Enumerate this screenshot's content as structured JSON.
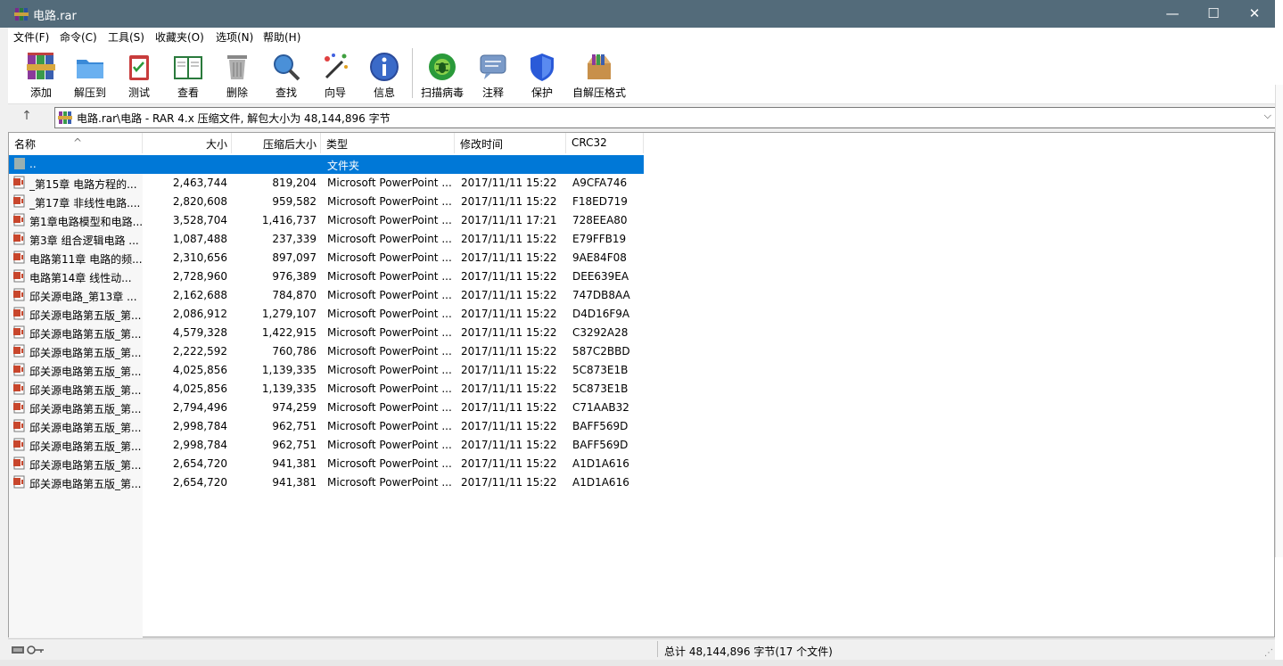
{
  "window": {
    "title": "电路.rar",
    "minimize": "—",
    "maximize": "☐",
    "close": "✕"
  },
  "menu": [
    "文件(F)",
    "命令(C)",
    "工具(S)",
    "收藏夹(O)",
    "选项(N)",
    "帮助(H)"
  ],
  "toolbar": {
    "add": "添加",
    "extract": "解压到",
    "test": "测试",
    "view": "查看",
    "delete": "删除",
    "find": "查找",
    "wizard": "向导",
    "info": "信息",
    "scan": "扫描病毒",
    "comment": "注释",
    "protect": "保护",
    "sfx": "自解压格式"
  },
  "address": {
    "up": "↑",
    "path": "电路.rar\\电路 - RAR 4.x 压缩文件, 解包大小为 48,144,896 字节",
    "drop": "⌵"
  },
  "columns": {
    "name": "名称",
    "size": "大小",
    "packed": "压缩后大小",
    "type": "类型",
    "modified": "修改时间",
    "crc": "CRC32"
  },
  "parent_row": {
    "name": "..",
    "type": "文件夹"
  },
  "files": [
    {
      "name": "_第15章 电路方程的...",
      "size": "2,463,744",
      "packed": "819,204",
      "type": "Microsoft PowerPoint ...",
      "modified": "2017/11/11 15:22",
      "crc": "A9CFA746"
    },
    {
      "name": "_第17章  非线性电路....",
      "size": "2,820,608",
      "packed": "959,582",
      "type": "Microsoft PowerPoint ...",
      "modified": "2017/11/11 15:22",
      "crc": "F18ED719"
    },
    {
      "name": "第1章电路模型和电路...",
      "size": "3,528,704",
      "packed": "1,416,737",
      "type": "Microsoft PowerPoint ...",
      "modified": "2017/11/11 17:21",
      "crc": "728EEA80"
    },
    {
      "name": "第3章 组合逻辑电路 ...",
      "size": "1,087,488",
      "packed": "237,339",
      "type": "Microsoft PowerPoint ...",
      "modified": "2017/11/11 15:22",
      "crc": "E79FFB19"
    },
    {
      "name": "电路第11章 电路的频...",
      "size": "2,310,656",
      "packed": "897,097",
      "type": "Microsoft PowerPoint ...",
      "modified": "2017/11/11 15:22",
      "crc": "9AE84F08"
    },
    {
      "name": "电路第14章  线性动...",
      "size": "2,728,960",
      "packed": "976,389",
      "type": "Microsoft PowerPoint ...",
      "modified": "2017/11/11 15:22",
      "crc": "DEE639EA"
    },
    {
      "name": "邱关源电路_第13章  ...",
      "size": "2,162,688",
      "packed": "784,870",
      "type": "Microsoft PowerPoint ...",
      "modified": "2017/11/11 15:22",
      "crc": "747DB8AA"
    },
    {
      "name": "邱关源电路第五版_第...",
      "size": "2,086,912",
      "packed": "1,279,107",
      "type": "Microsoft PowerPoint ...",
      "modified": "2017/11/11 15:22",
      "crc": "D4D16F9A"
    },
    {
      "name": "邱关源电路第五版_第...",
      "size": "4,579,328",
      "packed": "1,422,915",
      "type": "Microsoft PowerPoint ...",
      "modified": "2017/11/11 15:22",
      "crc": "C3292A28"
    },
    {
      "name": "邱关源电路第五版_第...",
      "size": "2,222,592",
      "packed": "760,786",
      "type": "Microsoft PowerPoint ...",
      "modified": "2017/11/11 15:22",
      "crc": "587C2BBD"
    },
    {
      "name": "邱关源电路第五版_第...",
      "size": "4,025,856",
      "packed": "1,139,335",
      "type": "Microsoft PowerPoint ...",
      "modified": "2017/11/11 15:22",
      "crc": "5C873E1B"
    },
    {
      "name": "邱关源电路第五版_第...",
      "size": "4,025,856",
      "packed": "1,139,335",
      "type": "Microsoft PowerPoint ...",
      "modified": "2017/11/11 15:22",
      "crc": "5C873E1B"
    },
    {
      "name": "邱关源电路第五版_第...",
      "size": "2,794,496",
      "packed": "974,259",
      "type": "Microsoft PowerPoint ...",
      "modified": "2017/11/11 15:22",
      "crc": "C71AAB32"
    },
    {
      "name": "邱关源电路第五版_第...",
      "size": "2,998,784",
      "packed": "962,751",
      "type": "Microsoft PowerPoint ...",
      "modified": "2017/11/11 15:22",
      "crc": "BAFF569D"
    },
    {
      "name": "邱关源电路第五版_第...",
      "size": "2,998,784",
      "packed": "962,751",
      "type": "Microsoft PowerPoint ...",
      "modified": "2017/11/11 15:22",
      "crc": "BAFF569D"
    },
    {
      "name": "邱关源电路第五版_第...",
      "size": "2,654,720",
      "packed": "941,381",
      "type": "Microsoft PowerPoint ...",
      "modified": "2017/11/11 15:22",
      "crc": "A1D1A616"
    },
    {
      "name": "邱关源电路第五版_第...",
      "size": "2,654,720",
      "packed": "941,381",
      "type": "Microsoft PowerPoint ...",
      "modified": "2017/11/11 15:22",
      "crc": "A1D1A616"
    }
  ],
  "status": {
    "total": "总计 48,144,896 字节(17 个文件)"
  },
  "colors": {
    "titlebar": "#536b7a",
    "selection": "#0078d7"
  }
}
